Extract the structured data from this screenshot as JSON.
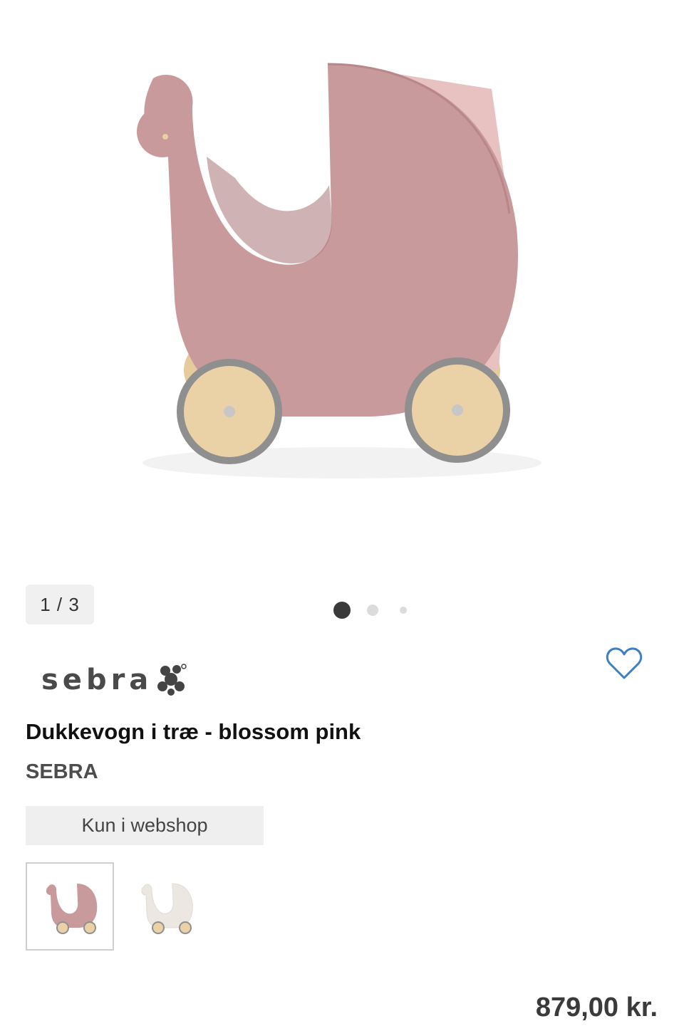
{
  "gallery": {
    "counter": "1 / 3",
    "current": 1,
    "total": 3
  },
  "brand": {
    "logo_text": "sebra",
    "name": "SEBRA"
  },
  "product": {
    "title": "Dukkevogn i træ - blossom pink",
    "availability_badge": "Kun i webshop",
    "price": "879,00 kr."
  },
  "variants": [
    {
      "color_name": "blossom pink",
      "color": "#c99a9b",
      "selected": true
    },
    {
      "color_name": "white",
      "color": "#ece7e0",
      "selected": false
    }
  ],
  "icons": {
    "favorite": "heart-outline-icon"
  },
  "colors": {
    "pram_pink": "#c99a9b",
    "wood": "#e9cfa2",
    "wheel_rim": "#9a9a9a",
    "favorite_blue": "#3b7fc4"
  }
}
